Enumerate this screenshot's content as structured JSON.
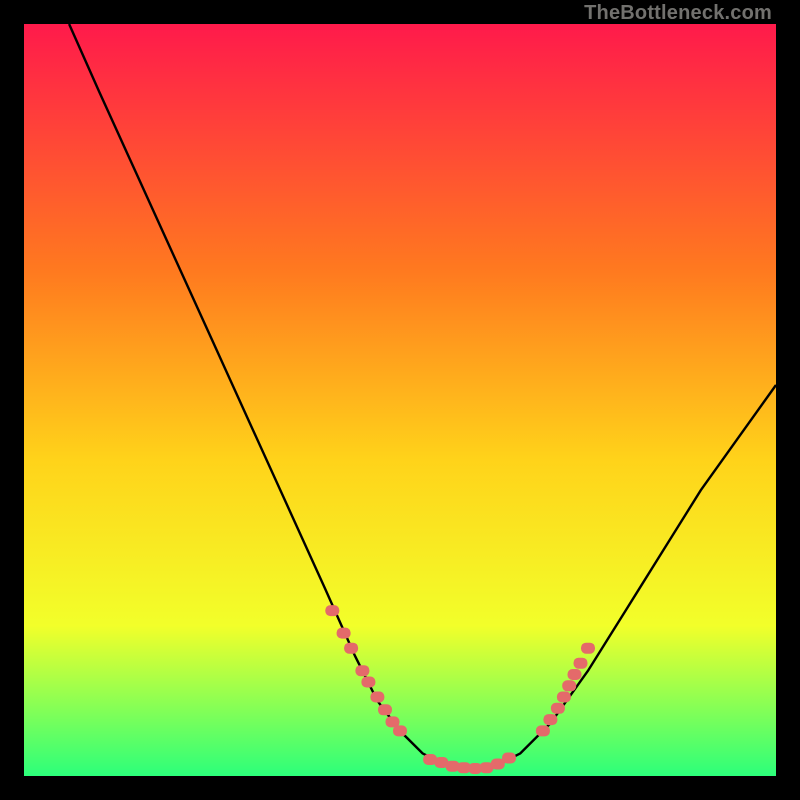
{
  "watermark": "TheBottleneck.com",
  "colors": {
    "bg": "#000000",
    "gradient_top": "#ff1a4b",
    "gradient_mid1": "#ff7a1f",
    "gradient_mid2": "#ffd31a",
    "gradient_mid3": "#f2ff2a",
    "gradient_bot": "#2cff7a",
    "curve": "#000000",
    "dots": "#e46a6a"
  },
  "chart_data": {
    "type": "line",
    "title": "",
    "xlabel": "",
    "ylabel": "",
    "xlim": [
      0,
      100
    ],
    "ylim": [
      0,
      100
    ],
    "series": [
      {
        "name": "bottleneck-curve",
        "x": [
          6,
          10,
          15,
          20,
          25,
          30,
          35,
          40,
          44,
          47,
          50,
          53,
          55,
          58,
          60,
          62,
          64,
          66,
          70,
          75,
          80,
          85,
          90,
          95,
          100
        ],
        "y": [
          100,
          91,
          80,
          69,
          58,
          47,
          36,
          25,
          16,
          10,
          6,
          3,
          2,
          1,
          1,
          1,
          2,
          3,
          7,
          14,
          22,
          30,
          38,
          45,
          52
        ]
      }
    ],
    "markers": [
      {
        "name": "left-cluster",
        "points": [
          {
            "x": 41,
            "y": 22
          },
          {
            "x": 42.5,
            "y": 19
          },
          {
            "x": 43.5,
            "y": 17
          },
          {
            "x": 45,
            "y": 14
          },
          {
            "x": 45.8,
            "y": 12.5
          },
          {
            "x": 47,
            "y": 10.5
          },
          {
            "x": 48,
            "y": 8.8
          },
          {
            "x": 49,
            "y": 7.2
          },
          {
            "x": 50,
            "y": 6
          }
        ]
      },
      {
        "name": "valley-cluster",
        "points": [
          {
            "x": 54,
            "y": 2.2
          },
          {
            "x": 55.5,
            "y": 1.8
          },
          {
            "x": 57,
            "y": 1.3
          },
          {
            "x": 58.5,
            "y": 1.1
          },
          {
            "x": 60,
            "y": 1.0
          },
          {
            "x": 61.5,
            "y": 1.1
          },
          {
            "x": 63,
            "y": 1.6
          },
          {
            "x": 64.5,
            "y": 2.4
          }
        ]
      },
      {
        "name": "right-cluster",
        "points": [
          {
            "x": 69,
            "y": 6
          },
          {
            "x": 70,
            "y": 7.5
          },
          {
            "x": 71,
            "y": 9
          },
          {
            "x": 71.8,
            "y": 10.5
          },
          {
            "x": 72.5,
            "y": 12
          },
          {
            "x": 73.2,
            "y": 13.5
          },
          {
            "x": 74,
            "y": 15
          },
          {
            "x": 75,
            "y": 17
          }
        ]
      }
    ]
  }
}
